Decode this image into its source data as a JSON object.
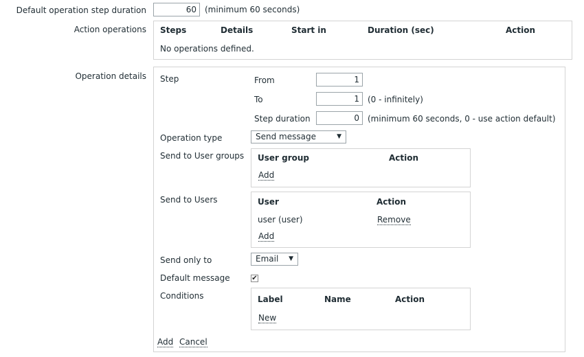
{
  "default_step_duration": {
    "label": "Default operation step duration",
    "value": "60",
    "hint": "(minimum 60 seconds)"
  },
  "action_operations": {
    "label": "Action operations",
    "columns": [
      "Steps",
      "Details",
      "Start in",
      "Duration (sec)",
      "Action"
    ],
    "empty_text": "No operations defined."
  },
  "operation_details": {
    "label": "Operation details",
    "step": {
      "label": "Step",
      "from_label": "From",
      "from_value": "1",
      "to_label": "To",
      "to_value": "1",
      "to_hint": "(0 - infinitely)",
      "duration_label": "Step duration",
      "duration_value": "0",
      "duration_hint": "(minimum 60 seconds, 0 - use action default)"
    },
    "operation_type": {
      "label": "Operation type",
      "selected": "Send message"
    },
    "user_groups": {
      "label": "Send to User groups",
      "columns": [
        "User group",
        "Action"
      ],
      "add_label": "Add"
    },
    "users": {
      "label": "Send to Users",
      "columns": [
        "User",
        "Action"
      ],
      "rows": [
        {
          "user": "user (user)",
          "action": "Remove"
        }
      ],
      "add_label": "Add"
    },
    "send_only_to": {
      "label": "Send only to",
      "selected": "Email"
    },
    "default_message": {
      "label": "Default message",
      "checked": true
    },
    "conditions": {
      "label": "Conditions",
      "columns": [
        "Label",
        "Name",
        "Action"
      ],
      "new_label": "New"
    },
    "footer": {
      "add_label": "Add",
      "cancel_label": "Cancel"
    }
  }
}
